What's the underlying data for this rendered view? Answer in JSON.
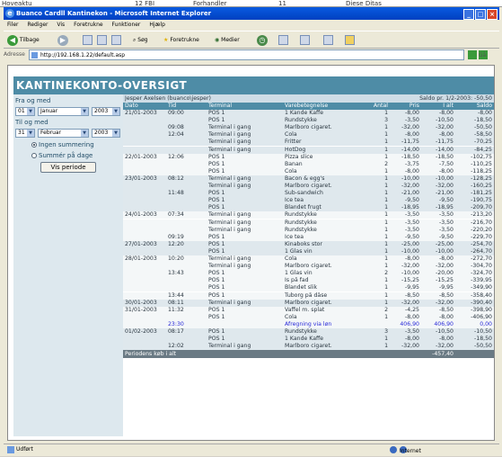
{
  "background_window": {
    "left_text": "Hoveaktu",
    "mid_text": "12 FBI",
    "right_text1": "Forhandler",
    "right_text2": "11",
    "right_text3": "Diese Ditas"
  },
  "window": {
    "title": "Buanco Cardll Kantinekon - Microsoft Internet Explorer"
  },
  "menu": [
    "Filer",
    "Rediger",
    "Vis",
    "Foretrukne",
    "Funktioner",
    "Hjælp"
  ],
  "toolbar": {
    "back_label": "Tilbage",
    "search_label": "Søg",
    "favorites_label": "Foretrukne",
    "media_label": "Medier"
  },
  "address": {
    "label": "Adresse",
    "url": "http://192.168.1.22/default.asp",
    "go_label": "Gå"
  },
  "app": {
    "title": "KANTINEKONTO-OVERSIGT"
  },
  "filter": {
    "from_label": "Fra og med",
    "from_day": "01",
    "from_month": "Januar",
    "from_year": "2003",
    "to_label": "Til og med",
    "to_day": "31",
    "to_month": "Februar",
    "to_year": "2003",
    "opt_none": "Ingen summering",
    "opt_days": "Summér på dage",
    "show_button": "Vis periode"
  },
  "account": {
    "user": "Jesper Axelsen (buanco\\jesper)",
    "saldo": "Saldo pr. 1/2-2003: -50,50"
  },
  "columns": [
    "Dato",
    "Tid",
    "Terminal",
    "Varebetegnelse",
    "Antal",
    "Pris",
    "I alt",
    "Saldo"
  ],
  "rows": [
    [
      "21/01-2003",
      "09:00",
      "POS 1",
      "1 Kande Kaffe",
      "1",
      "-8,00",
      "-8,00",
      "-8,00"
    ],
    [
      "",
      "",
      "POS 1",
      "Rundstykke",
      "3",
      "-3,50",
      "-10,50",
      "-18,50"
    ],
    [
      "",
      "09:08",
      "Terminal i gang",
      "Marlboro cigaret.",
      "1",
      "-32,00",
      "-32,00",
      "-50,50"
    ],
    [
      "",
      "12:04",
      "Terminal i gang",
      "Cola",
      "1",
      "-8,00",
      "-8,00",
      "-58,50"
    ],
    [
      "",
      "",
      "Terminal i gang",
      "Fritter",
      "1",
      "-11,75",
      "-11,75",
      "-70,25"
    ],
    [
      "",
      "",
      "Terminal i gang",
      "HotDog",
      "1",
      "-14,00",
      "-14,00",
      "-84,25"
    ],
    [
      "22/01-2003",
      "12:06",
      "POS 1",
      "Pizza slice",
      "1",
      "-18,50",
      "-18,50",
      "-102,75"
    ],
    [
      "",
      "",
      "POS 1",
      "Banan",
      "2",
      "-3,75",
      "-7,50",
      "-110,25"
    ],
    [
      "",
      "",
      "POS 1",
      "Cola",
      "1",
      "-8,00",
      "-8,00",
      "-118,25"
    ],
    [
      "23/01-2003",
      "08:12",
      "Terminal i gang",
      "Bacon & egg's",
      "1",
      "-10,00",
      "-10,00",
      "-128,25"
    ],
    [
      "",
      "",
      "Terminal i gang",
      "Marlboro cigaret.",
      "1",
      "-32,00",
      "-32,00",
      "-160,25"
    ],
    [
      "",
      "11:48",
      "POS 1",
      "Sub-sandwich",
      "1",
      "-21,00",
      "-21,00",
      "-181,25"
    ],
    [
      "",
      "",
      "POS 1",
      "Ice tea",
      "1",
      "-9,50",
      "-9,50",
      "-190,75"
    ],
    [
      "",
      "",
      "POS 1",
      "Blandet frugt",
      "1",
      "-18,95",
      "-18,95",
      "-209,70"
    ],
    [
      "24/01-2003",
      "07:34",
      "Terminal i gang",
      "Rundstykke",
      "1",
      "-3,50",
      "-3,50",
      "-213,20"
    ],
    [
      "",
      "",
      "Terminal i gang",
      "Rundstykke",
      "1",
      "-3,50",
      "-3,50",
      "-216,70"
    ],
    [
      "",
      "",
      "Terminal i gang",
      "Rundstykke",
      "1",
      "-3,50",
      "-3,50",
      "-220,20"
    ],
    [
      "",
      "09:19",
      "POS 1",
      "Ice tea",
      "1",
      "-9,50",
      "-9,50",
      "-229,70"
    ],
    [
      "27/01-2003",
      "12:20",
      "POS 1",
      "Kinaboks stor",
      "1",
      "-25,00",
      "-25,00",
      "-254,70"
    ],
    [
      "",
      "",
      "POS 1",
      "1 Glas vin",
      "1",
      "-10,00",
      "-10,00",
      "-264,70"
    ],
    [
      "28/01-2003",
      "10:20",
      "Terminal i gang",
      "Cola",
      "1",
      "-8,00",
      "-8,00",
      "-272,70"
    ],
    [
      "",
      "",
      "Terminal i gang",
      "Marlboro cigaret.",
      "1",
      "-32,00",
      "-32,00",
      "-304,70"
    ],
    [
      "",
      "13:43",
      "POS 1",
      "1 Glas vin",
      "2",
      "-10,00",
      "-20,00",
      "-324,70"
    ],
    [
      "",
      "",
      "POS 1",
      "Is på fad",
      "1",
      "-15,25",
      "-15,25",
      "-339,95"
    ],
    [
      "",
      "",
      "POS 1",
      "Blandet slik",
      "1",
      "-9,95",
      "-9,95",
      "-349,90"
    ],
    [
      "",
      "13:44",
      "POS 1",
      "Tuborg på dåse",
      "1",
      "-8,50",
      "-8,50",
      "-358,40"
    ],
    [
      "30/01-2003",
      "08:11",
      "Terminal i gang",
      "Marlboro cigaret.",
      "1",
      "-32,00",
      "-32,00",
      "-390,40"
    ],
    [
      "31/01-2003",
      "11:32",
      "POS 1",
      "Vaffel m. splat",
      "2",
      "-4,25",
      "-8,50",
      "-398,90"
    ],
    [
      "",
      "",
      "POS 1",
      "Cola",
      "1",
      "-8,00",
      "-8,00",
      "-406,90"
    ],
    [
      "",
      "23:30",
      "",
      "Afregning via løn",
      "",
      "406,90",
      "406,90",
      "0,00"
    ],
    [
      "01/02-2003",
      "08:17",
      "POS 1",
      "Rundstykke",
      "3",
      "-3,50",
      "-10,50",
      "-10,50"
    ],
    [
      "",
      "",
      "POS 1",
      "1 Kande Kaffe",
      "1",
      "-8,00",
      "-8,00",
      "-18,50"
    ],
    [
      "",
      "12:02",
      "Terminal i gang",
      "Marlboro cigaret.",
      "1",
      "-32,00",
      "-32,00",
      "-50,50"
    ]
  ],
  "footer": {
    "label": "Periodens køb i alt",
    "total": "-457,40"
  },
  "status": {
    "left": "Udført",
    "zone": "Internet"
  }
}
